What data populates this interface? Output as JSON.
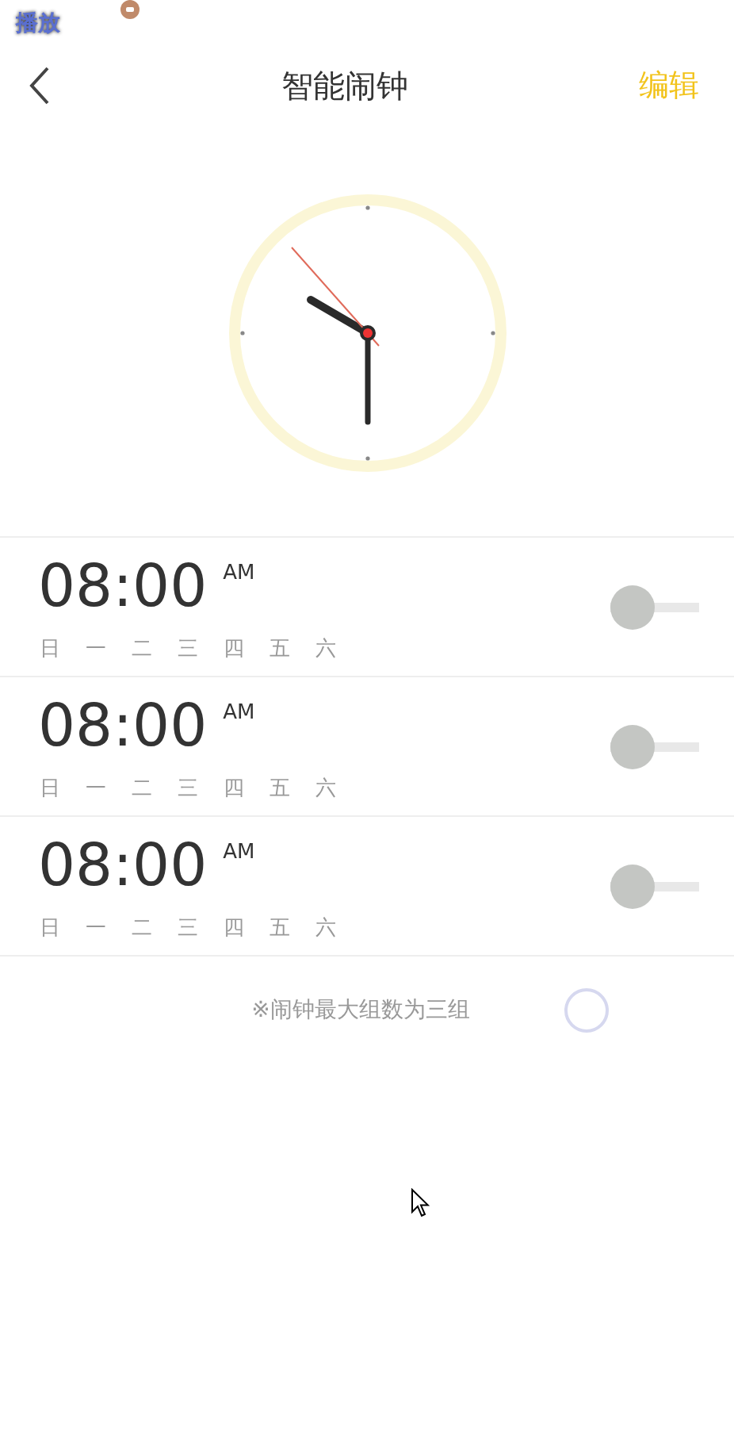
{
  "overlay": {
    "label": "播放"
  },
  "header": {
    "title": "智能闹钟",
    "action": "编辑"
  },
  "alarms": [
    {
      "time": "08:00",
      "period": "AM",
      "days": [
        "日",
        "一",
        "二",
        "三",
        "四",
        "五",
        "六"
      ],
      "on": false
    },
    {
      "time": "08:00",
      "period": "AM",
      "days": [
        "日",
        "一",
        "二",
        "三",
        "四",
        "五",
        "六"
      ],
      "on": false
    },
    {
      "time": "08:00",
      "period": "AM",
      "days": [
        "日",
        "一",
        "二",
        "三",
        "四",
        "五",
        "六"
      ],
      "on": false
    }
  ],
  "note": "※闹钟最大组数为三组"
}
